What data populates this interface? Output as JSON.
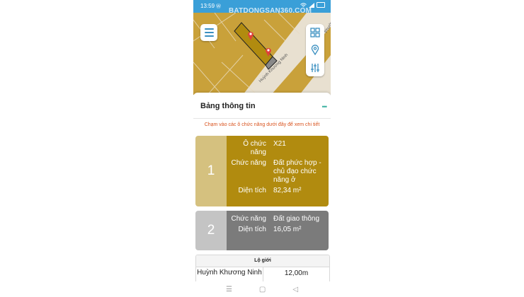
{
  "status_bar": {
    "time": "13:59",
    "indicator": "Ⓦ"
  },
  "watermark": "BATDONGSAN360.COM",
  "map": {
    "road_label_main": "Huỳnh Khương Ninh",
    "road_label_side": "Phường",
    "colors": {
      "land": "#c9a13a",
      "road": "#e8e0d0",
      "parcel": "#b18b0f",
      "pin": "#e0403a"
    }
  },
  "toolbar": {
    "menu_icon": "menu-icon",
    "tools": [
      "grid-icon",
      "location-pin-icon",
      "sliders-icon"
    ]
  },
  "panel": {
    "title": "Bảng thông tin",
    "more": "•••",
    "hint": "Chạm vào các ô chức năng dưới đây để xem chi tiết",
    "cards": [
      {
        "number": "1",
        "rows": [
          {
            "label": "Ô chức năng",
            "value": "X21"
          },
          {
            "label": "Chức năng",
            "value": "Đất phức hợp - chủ đạo chức năng ở"
          },
          {
            "label": "Diện tích",
            "value": "82,34 m²"
          }
        ]
      },
      {
        "number": "2",
        "rows": [
          {
            "label": "Chức năng",
            "value": "Đất giao thông"
          },
          {
            "label": "Diện tích",
            "value": "16,05 m²"
          }
        ]
      }
    ],
    "lo_gioi": {
      "header": "Lộ giới",
      "rows": [
        {
          "road": "Huỳnh Khương Ninh",
          "width": "12,00m"
        }
      ]
    }
  },
  "navbar": {
    "menu": "☰",
    "home": "▢",
    "back": "◁"
  }
}
